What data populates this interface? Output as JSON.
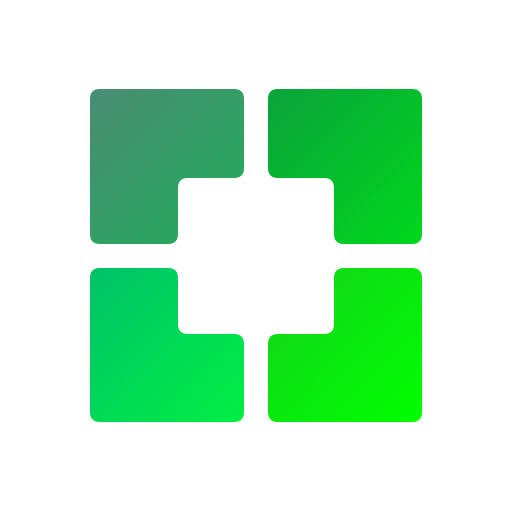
{
  "logo": {
    "icon": "four-corner-bracket-logo-icon",
    "background_color": "#ffffff",
    "quadrants": {
      "top_left": {
        "from": "#4a8c74",
        "to": "#1fae57"
      },
      "top_right": {
        "from": "#0aa33c",
        "to": "#00d81c"
      },
      "bottom_left": {
        "from": "#00c26a",
        "to": "#00ef43"
      },
      "bottom_right": {
        "from": "#14d21c",
        "to": "#00ff00"
      }
    }
  }
}
